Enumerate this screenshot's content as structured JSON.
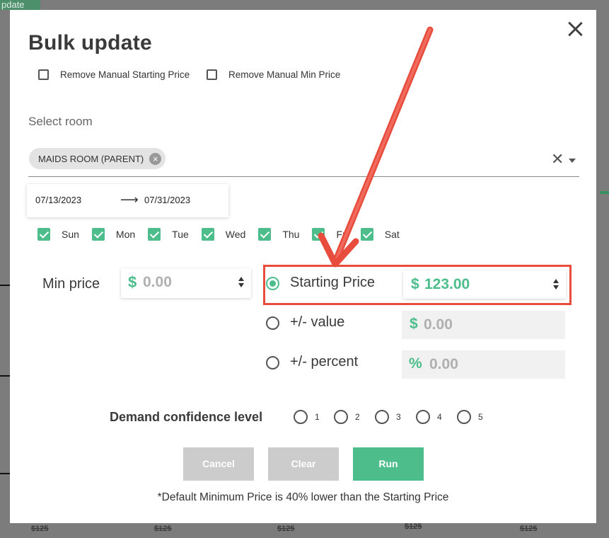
{
  "background": {
    "tag_label": "pdate",
    "strike_prices": [
      "$125",
      "$125",
      "$125",
      "$125",
      "$125"
    ]
  },
  "modal": {
    "title": "Bulk update",
    "checkboxes": [
      {
        "label": "Remove Manual Starting Price",
        "checked": false
      },
      {
        "label": "Remove Manual Min Price",
        "checked": false
      }
    ],
    "select_room": {
      "label": "Select room",
      "chip": "MAIDS ROOM (PARENT)"
    },
    "dates": {
      "start": "07/13/2023",
      "end": "07/31/2023"
    },
    "days": [
      {
        "label": "Sun",
        "checked": true
      },
      {
        "label": "Mon",
        "checked": true
      },
      {
        "label": "Tue",
        "checked": true
      },
      {
        "label": "Wed",
        "checked": true
      },
      {
        "label": "Thu",
        "checked": true
      },
      {
        "label": "Fri",
        "checked": true
      },
      {
        "label": "Sat",
        "checked": true
      }
    ],
    "min_price": {
      "label": "Min price",
      "currency": "$",
      "value": "0.00"
    },
    "price_options": [
      {
        "label": "Starting Price",
        "selected": true,
        "prefix": "$",
        "value": "123.00"
      },
      {
        "label": "+/- value",
        "selected": false,
        "prefix": "$",
        "value": "0.00"
      },
      {
        "label": "+/- percent",
        "selected": false,
        "prefix": "%",
        "value": "0.00"
      }
    ],
    "demand": {
      "label": "Demand confidence level",
      "levels": [
        "1",
        "2",
        "3",
        "4",
        "5"
      ]
    },
    "buttons": {
      "cancel": "Cancel",
      "clear": "Clear",
      "run": "Run"
    },
    "footnote": "*Default Minimum Price is 40% lower than the Starting Price"
  },
  "colors": {
    "accent": "#4dbd8b",
    "annotation": "#e74c3c",
    "disabled_button": "#cccccc"
  }
}
